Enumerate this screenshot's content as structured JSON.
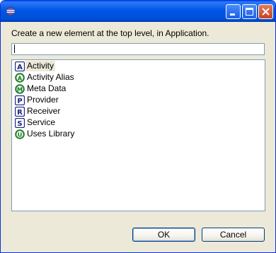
{
  "dialog": {
    "prompt": "Create a new element at the top level, in Application.",
    "filter_value": ""
  },
  "elements": [
    {
      "label": "Activity",
      "icon": "activity-icon",
      "letter": "A",
      "shape": "square",
      "selected": true
    },
    {
      "label": "Activity Alias",
      "icon": "activity-alias-icon",
      "letter": "A",
      "shape": "circle",
      "selected": false
    },
    {
      "label": "Meta Data",
      "icon": "meta-data-icon",
      "letter": "M",
      "shape": "circle",
      "selected": false
    },
    {
      "label": "Provider",
      "icon": "provider-icon",
      "letter": "P",
      "shape": "square",
      "selected": false
    },
    {
      "label": "Receiver",
      "icon": "receiver-icon",
      "letter": "R",
      "shape": "square",
      "selected": false
    },
    {
      "label": "Service",
      "icon": "service-icon",
      "letter": "S",
      "shape": "square",
      "selected": false
    },
    {
      "label": "Uses Library",
      "icon": "uses-library-icon",
      "letter": "U",
      "shape": "circle",
      "selected": false
    }
  ],
  "buttons": {
    "ok": "OK",
    "cancel": "Cancel"
  },
  "colors": {
    "titlebar": "#0055e5",
    "close_button": "#c8421f",
    "dialog_background": "#ece9d8",
    "square_icon_border": "#1a237e",
    "circle_icon_fill": "#2e9b3a"
  }
}
